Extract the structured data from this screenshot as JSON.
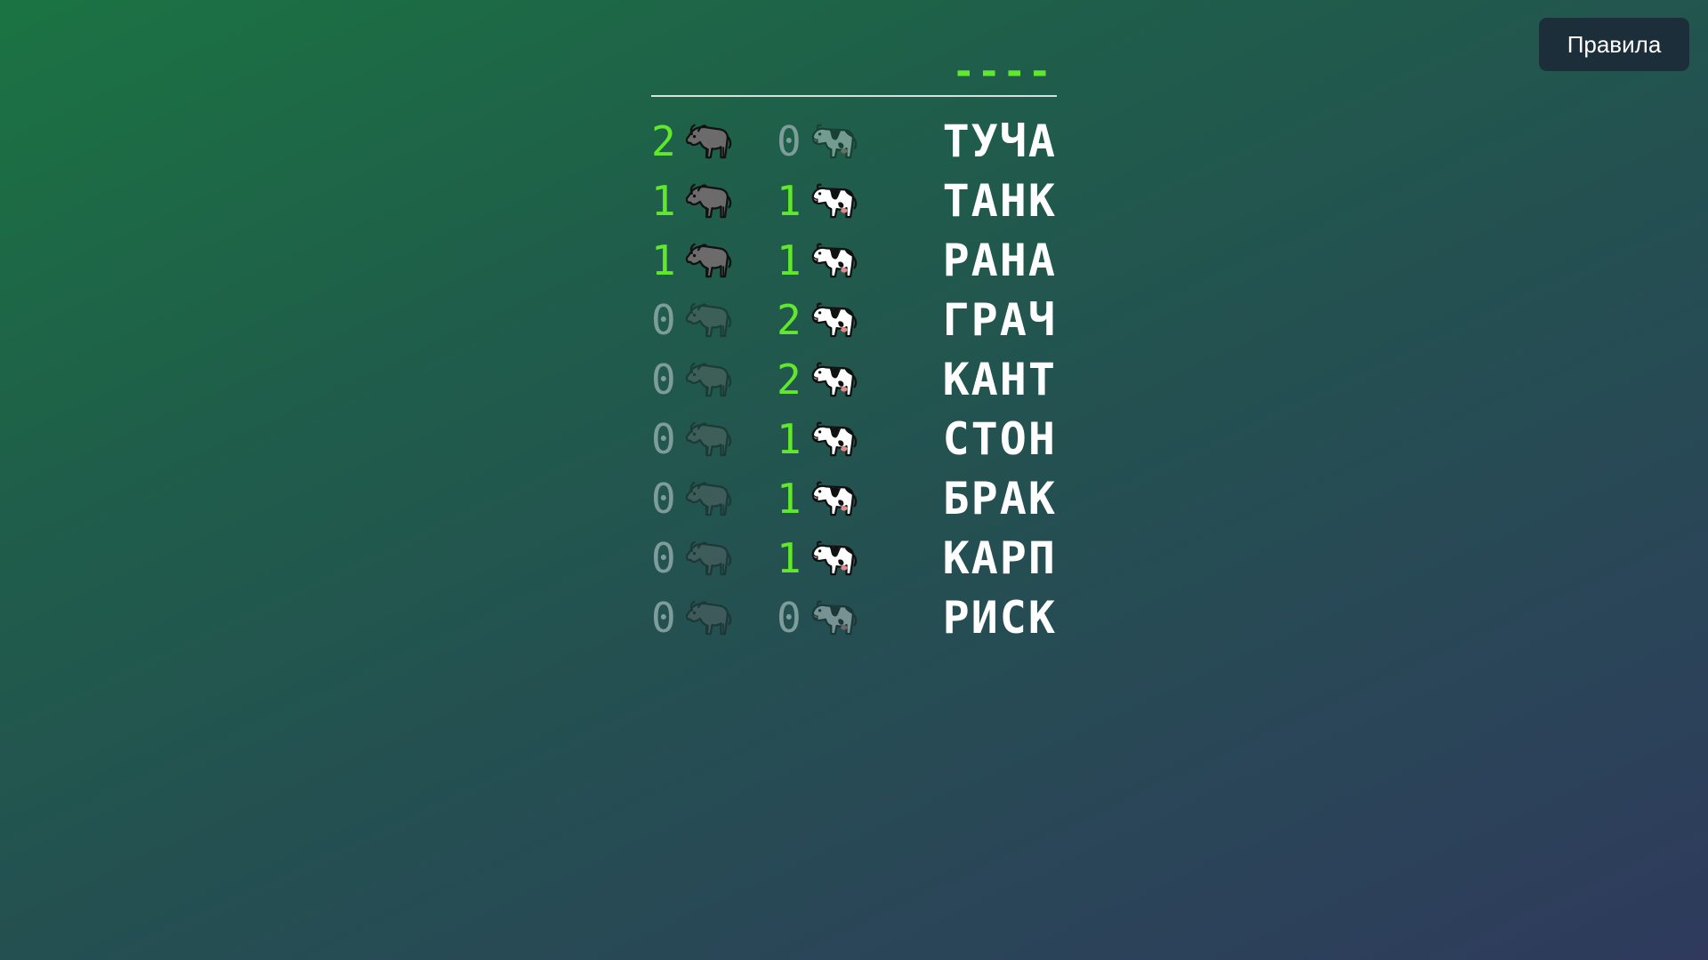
{
  "header": {
    "rules_label": "Правила"
  },
  "current_guess": "----",
  "rows": [
    {
      "bulls": "2",
      "cows": "0",
      "word": "ТУЧА"
    },
    {
      "bulls": "1",
      "cows": "1",
      "word": "ТАНК"
    },
    {
      "bulls": "1",
      "cows": "1",
      "word": "РАНА"
    },
    {
      "bulls": "0",
      "cows": "2",
      "word": "ГРАЧ"
    },
    {
      "bulls": "0",
      "cows": "2",
      "word": "КАНТ"
    },
    {
      "bulls": "0",
      "cows": "1",
      "word": "СТОН"
    },
    {
      "bulls": "0",
      "cows": "1",
      "word": "БРАК"
    },
    {
      "bulls": "0",
      "cows": "1",
      "word": "КАРП"
    },
    {
      "bulls": "0",
      "cows": "0",
      "word": "РИСК"
    }
  ],
  "icons": {
    "bull": "bull-icon",
    "cow": "cow-icon"
  },
  "colors": {
    "accent_green": "#62e82a",
    "zero_gray": "#7d9c9a",
    "button_bg": "#1c2e3a"
  }
}
